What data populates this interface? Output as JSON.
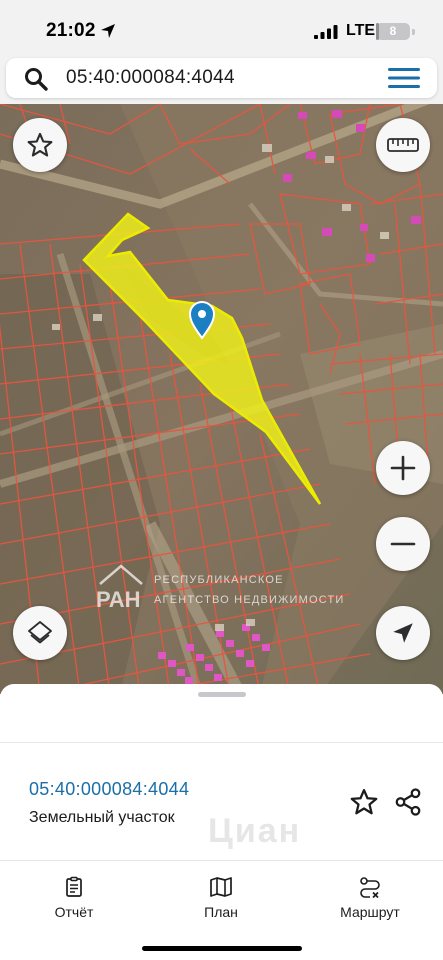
{
  "status_bar": {
    "time": "21:02",
    "network": "LTE",
    "battery": "8",
    "battery_level": 0.08
  },
  "search": {
    "query": "05:40:000084:4044",
    "icon": "search-icon",
    "menu_icon": "menu-icon"
  },
  "map": {
    "buttons": {
      "favorite_icon": "star-icon",
      "ruler_icon": "ruler-icon",
      "zoom_in_icon": "plus-icon",
      "zoom_out_icon": "minus-icon",
      "layers_icon": "layers-icon",
      "locate_icon": "navigation-arrow-icon"
    },
    "watermark": {
      "line1": "РЕСПУБЛИКАНСКОЕ",
      "line2": "АГЕНТСТВО НЕДВИЖИМОСТИ",
      "logo": "РАН"
    },
    "colors": {
      "parcel_fill": "#f2f21a",
      "parcel_border": "#e8e800",
      "cadastre_lines": "#e8553f",
      "marker": "#1c7fc4"
    }
  },
  "bottom_sheet": {
    "parcel_id": "05:40:000084:4044",
    "parcel_type": "Земельный участок",
    "watermark": "Циан",
    "actions": {
      "favorite_icon": "star-outline-icon",
      "share_icon": "share-icon"
    },
    "tabs": [
      {
        "label": "Отчёт",
        "icon": "report-icon"
      },
      {
        "label": "План",
        "icon": "map-icon"
      },
      {
        "label": "Маршрут",
        "icon": "route-icon"
      }
    ]
  }
}
